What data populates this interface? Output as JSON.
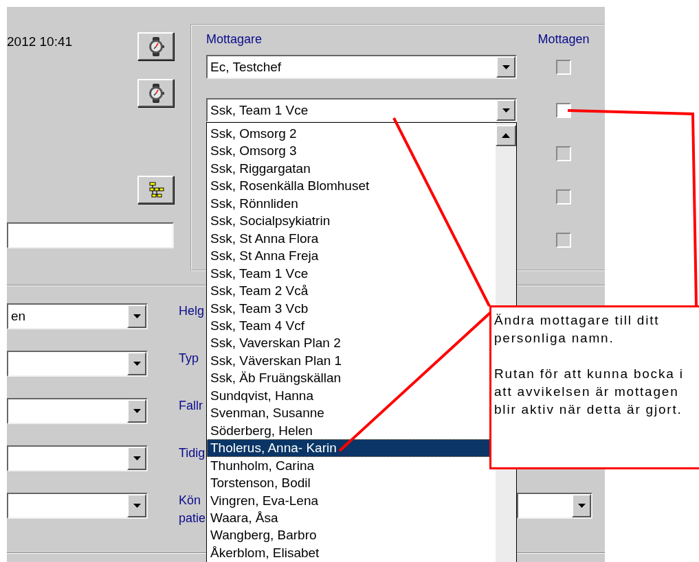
{
  "datetime": "2012 10:41",
  "recipients_panel": {
    "recipient_header": "Mottagare",
    "received_header": "Mottagen",
    "recipients": [
      {
        "value": "Ec, Testchef"
      },
      {
        "value": "Ssk, Team 1 Vce"
      }
    ],
    "received_checks": [
      {
        "checked": false,
        "disabled": true
      },
      {
        "checked": false,
        "disabled": false
      },
      {
        "checked": false,
        "disabled": true
      },
      {
        "checked": false,
        "disabled": true
      },
      {
        "checked": false,
        "disabled": true
      }
    ]
  },
  "dropdown_list": {
    "items": [
      {
        "label": "Ssk, Omsorg 2",
        "selected": false
      },
      {
        "label": "Ssk, Omsorg 3",
        "selected": false
      },
      {
        "label": "Ssk, Riggargatan",
        "selected": false
      },
      {
        "label": "Ssk, Rosenkälla Blomhuset",
        "selected": false
      },
      {
        "label": "Ssk, Rönnliden",
        "selected": false
      },
      {
        "label": "Ssk, Socialpsykiatrin",
        "selected": false
      },
      {
        "label": "Ssk, St Anna Flora",
        "selected": false
      },
      {
        "label": "Ssk, St Anna Freja",
        "selected": false
      },
      {
        "label": "Ssk, Team 1 Vce",
        "selected": false
      },
      {
        "label": "Ssk, Team 2 Vcå",
        "selected": false
      },
      {
        "label": "Ssk, Team 3 Vcb",
        "selected": false
      },
      {
        "label": "Ssk, Team 4 Vcf",
        "selected": false
      },
      {
        "label": "Ssk, Vaverskan Plan 2",
        "selected": false
      },
      {
        "label": "Ssk, Väverskan Plan 1",
        "selected": false
      },
      {
        "label": "Ssk, Äb Fruängskällan",
        "selected": false
      },
      {
        "label": "Sundqvist, Hanna",
        "selected": false
      },
      {
        "label": "Svenman, Susanne",
        "selected": false
      },
      {
        "label": "Söderberg, Helen",
        "selected": false
      },
      {
        "label": "Tholerus, Anna- Karin",
        "selected": true
      },
      {
        "label": "Thunholm, Carina",
        "selected": false
      },
      {
        "label": "Torstenson, Bodil",
        "selected": false
      },
      {
        "label": "Vingren, Eva-Lena",
        "selected": false
      },
      {
        "label": "Waara, Åsa",
        "selected": false
      },
      {
        "label": "Wangberg, Barbro",
        "selected": false
      },
      {
        "label": "Åkerblom, Elisabet",
        "selected": false
      }
    ]
  },
  "form_rows": [
    {
      "label": [
        "Helg"
      ],
      "value": "en"
    },
    {
      "label": [
        "Typ"
      ]
    },
    {
      "label": [
        "Fallr"
      ]
    },
    {
      "label": [
        "Tidig"
      ]
    },
    {
      "label": [
        "Kön",
        "patie"
      ],
      "second_field": true
    }
  ],
  "annotation": {
    "paragraphs": [
      "Ändra mottagare till ditt personliga namn.",
      "Rutan för att kunna bocka i att avvikelsen är mottagen blir aktiv när detta är gjort."
    ]
  }
}
